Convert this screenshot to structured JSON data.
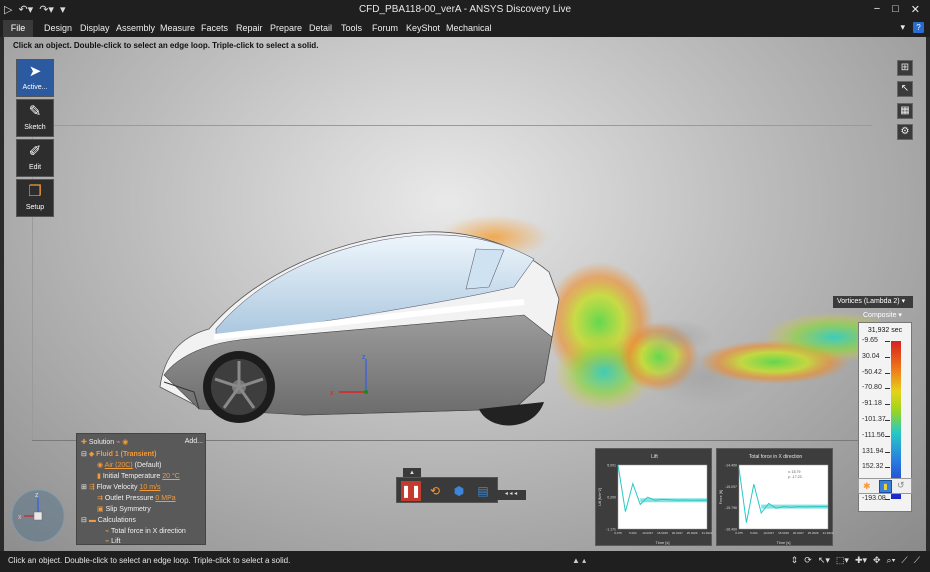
{
  "titlebar": {
    "title": "CFD_PBA118-00_verA - ANSYS Discovery Live",
    "minimize": "−",
    "maximize": "□",
    "close": "✕"
  },
  "menu": {
    "file": "File",
    "items": [
      "Design",
      "Display",
      "Assembly",
      "Measure",
      "Facets",
      "Repair",
      "Prepare",
      "Detail",
      "Tools",
      "Forum",
      "KeyShot",
      "Mechanical"
    ],
    "help": "?"
  },
  "viewport": {
    "hint": "Click an object. Double-click to select an edge loop. Triple-click to select a solid."
  },
  "tools": [
    {
      "label": "Active...",
      "icon": "arrow-pointer-icon"
    },
    {
      "label": "Sketch",
      "icon": "pencil-icon"
    },
    {
      "label": "Edit",
      "icon": "edit-brush-icon"
    },
    {
      "label": "Setup",
      "icon": "setup-cube-icon"
    }
  ],
  "solution": {
    "title": "Solution",
    "add_label": "Add...",
    "fluid": "Fluid 1 (Transient)",
    "air": "Air (20C)",
    "air_default": "(Default)",
    "initial_temp_label": "Initial Temperature",
    "initial_temp_value": "20 °C",
    "flow_velocity_label": "Flow Velocity",
    "flow_velocity_value": "10 m/s",
    "outlet_pressure_label": "Outlet Pressure",
    "outlet_pressure_value": "0 MPa",
    "slip_symmetry": "Slip Symmetry",
    "calculations": "Calculations",
    "calc_items": [
      "Total force in X direction",
      "Lift"
    ]
  },
  "legend": {
    "field": "Vortices (Lambda 2)",
    "mode": "Composite",
    "time": "31,932 sec",
    "labels": [
      "-9.65",
      "30.04",
      "-50.42",
      "-70.80",
      "-91.18",
      "-101.37",
      "-111.56",
      "131.94",
      "152.32",
      "-172.70",
      "-193.08"
    ]
  },
  "charts": [
    {
      "title": "Lift",
      "ylabel": "Lift [N/m^2]",
      "xlabel": "Time [s]",
      "yticks": [
        "5.001",
        "0.200",
        "-1.171"
      ],
      "xticks": [
        "0.075",
        "5.004",
        "10.0047",
        "15.0025",
        "20.0047",
        "25.0026",
        "31.9322"
      ],
      "chart_data": {
        "type": "line",
        "x_range": [
          0.075,
          31.932
        ],
        "y_range": [
          -1.171,
          5.001
        ],
        "series": [
          {
            "values": [
              5.0,
              0.5,
              3.2,
              1.2,
              1.9,
              1.6,
              1.7,
              1.65,
              1.6,
              1.62,
              1.6,
              1.61,
              1.6
            ]
          }
        ]
      }
    },
    {
      "title": "Total force in X direction",
      "ylabel": "Force [N]",
      "xlabel": "Time [s]",
      "yticks": [
        "-14.400",
        "-15.097",
        "-15.796",
        "-16.400"
      ],
      "xticks": [
        "0.075",
        "5.004",
        "10.0047",
        "15.0025",
        "20.0047",
        "25.0026",
        "31.9322"
      ],
      "readout": [
        "x: 15.79",
        "y: -17.23"
      ],
      "chart_data": {
        "type": "line",
        "x_range": [
          0.075,
          31.932
        ],
        "y_range": [
          -16.4,
          -14.4
        ],
        "series": [
          {
            "values": [
              -14.5,
              -16.2,
              -15.0,
              -15.9,
              -15.6,
              -15.75,
              -15.7,
              -15.72,
              -15.7,
              -15.71,
              -15.7,
              -15.7,
              -15.7
            ]
          }
        ]
      }
    }
  ],
  "statusbar": {
    "message": "Click an object. Double-click to select an edge loop. Triple-click to select a solid."
  },
  "colors": {
    "accent": "#2c5aa0",
    "orange": "#f39a3a",
    "teal_line": "#27c9c4"
  }
}
